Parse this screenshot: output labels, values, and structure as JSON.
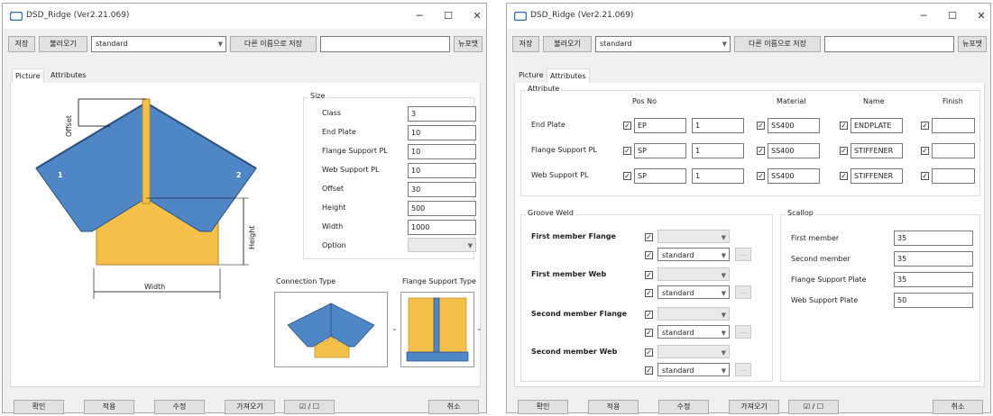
{
  "left": {
    "title": "DSD_Ridge (Ver2.21.069)",
    "window_controls": {
      "minimize": "─",
      "maximize": "☐",
      "close": "✕"
    },
    "toolbar": {
      "save": "저장",
      "load": "불러오기",
      "preset": "standard",
      "save_as": "다른 이름으로 저장",
      "new_value": "",
      "update": "뉴포맷"
    },
    "tabs": {
      "picture": "Picture",
      "attributes": "Attributes"
    },
    "figure": {
      "offset": "Offset",
      "height": "Height",
      "width": "Width",
      "member1": "1",
      "member2": "2"
    },
    "size": {
      "title": "Size",
      "rows": [
        {
          "label": "Class",
          "value": "3"
        },
        {
          "label": "End Plate",
          "value": "10"
        },
        {
          "label": "Flange Support PL",
          "value": "10"
        },
        {
          "label": "Web Support PL",
          "value": "10"
        },
        {
          "label": "Offset",
          "value": "30"
        },
        {
          "label": "Height",
          "value": "500"
        },
        {
          "label": "Width",
          "value": "1000"
        }
      ],
      "option_label": "Option",
      "option_value": ""
    },
    "connection_type": "Connection Type",
    "flange_support_type": "Flange Support Type",
    "footer": {
      "ok": "확인",
      "apply": "적용",
      "modify": "수정",
      "get": "가져오기",
      "toggle": "☑ / ☐",
      "cancel": "취소"
    }
  },
  "right": {
    "title": "DSD_Ridge (Ver2.21.069)",
    "window_controls": {
      "minimize": "─",
      "maximize": "☐",
      "close": "✕"
    },
    "toolbar": {
      "save": "저장",
      "load": "불러오기",
      "preset": "standard",
      "save_as": "다른 이름으로 저장",
      "new_value": "",
      "update": "뉴포맷"
    },
    "tabs": {
      "picture": "Picture",
      "attributes": "Attributes"
    },
    "attributes": {
      "title": "Attribute",
      "columns": {
        "pos_no": "Pos No",
        "material": "Material",
        "name": "Name",
        "finish": "Finish"
      },
      "rows": [
        {
          "label": "End Plate",
          "prefix": "EP",
          "start": "1",
          "material": "SS400",
          "name": "ENDPLATE",
          "finish": ""
        },
        {
          "label": "Flange Support PL",
          "prefix": "SP",
          "start": "1",
          "material": "SS400",
          "name": "STIFFENER",
          "finish": ""
        },
        {
          "label": "Web Support PL",
          "prefix": "SP",
          "start": "1",
          "material": "SS400",
          "name": "STIFFENER",
          "finish": ""
        }
      ]
    },
    "groove": {
      "title": "Groove Weld",
      "rows": [
        {
          "label": "First member Flange",
          "value": "standard"
        },
        {
          "label": "First member Web",
          "value": "standard"
        },
        {
          "label": "Second member Flange",
          "value": "standard"
        },
        {
          "label": "Second member Web",
          "value": "standard"
        }
      ],
      "dots": "..."
    },
    "scallop": {
      "title": "Scallop",
      "rows": [
        {
          "label": "First member",
          "value": "35"
        },
        {
          "label": "Second member",
          "value": "35"
        },
        {
          "label": "Flange Support Plate",
          "value": "35"
        },
        {
          "label": "Web Support Plate",
          "value": "50"
        }
      ]
    },
    "footer": {
      "ok": "확인",
      "apply": "적용",
      "modify": "수정",
      "get": "가져오기",
      "toggle": "☑ / ☐",
      "cancel": "취소"
    }
  }
}
